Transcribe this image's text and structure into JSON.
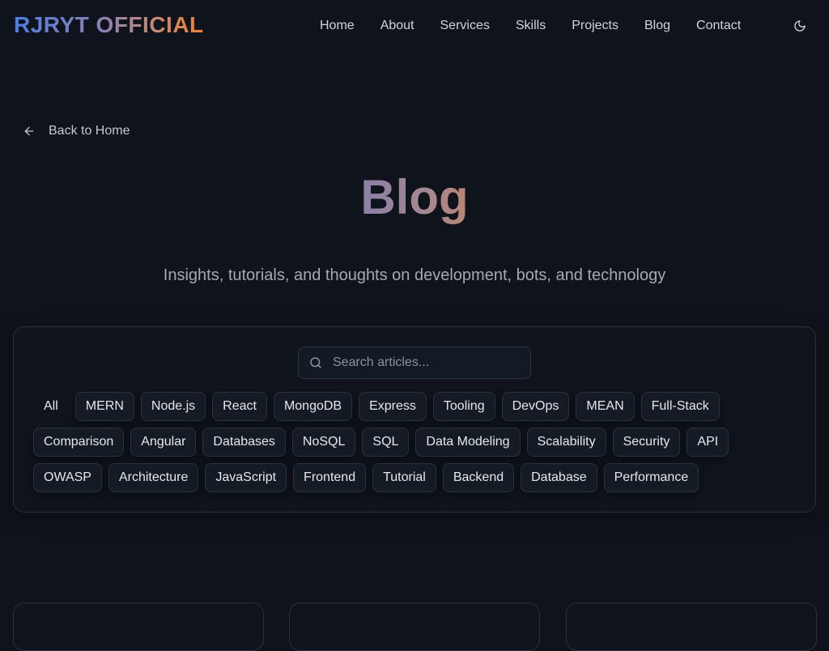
{
  "header": {
    "logo_part1": "RJRYT",
    "logo_part2": "OFFICIAL",
    "nav": [
      "Home",
      "About",
      "Services",
      "Skills",
      "Projects",
      "Blog",
      "Contact"
    ],
    "theme_icon": "moon-icon"
  },
  "back": {
    "label": "Back to Home",
    "icon": "arrow-left-icon"
  },
  "page": {
    "title": "Blog",
    "subtitle": "Insights, tutorials, and thoughts on development, bots, and technology"
  },
  "search": {
    "placeholder": "Search articles...",
    "value": "",
    "icon": "search-icon"
  },
  "tags": {
    "active": "All",
    "items": [
      "All",
      "MERN",
      "Node.js",
      "React",
      "MongoDB",
      "Express",
      "Tooling",
      "DevOps",
      "MEAN",
      "Full-Stack",
      "Comparison",
      "Angular",
      "Databases",
      "NoSQL",
      "SQL",
      "Data Modeling",
      "Scalability",
      "Security",
      "API",
      "OWASP",
      "Architecture",
      "JavaScript",
      "Frontend",
      "Tutorial",
      "Backend",
      "Database",
      "Performance"
    ]
  },
  "colors": {
    "background": "#0f131b",
    "logo_gradient_start": "#4b7fe0",
    "logo_gradient_end": "#ef7f2e",
    "title_gradient_start": "#8a7fa8",
    "title_gradient_end": "#b98674"
  }
}
